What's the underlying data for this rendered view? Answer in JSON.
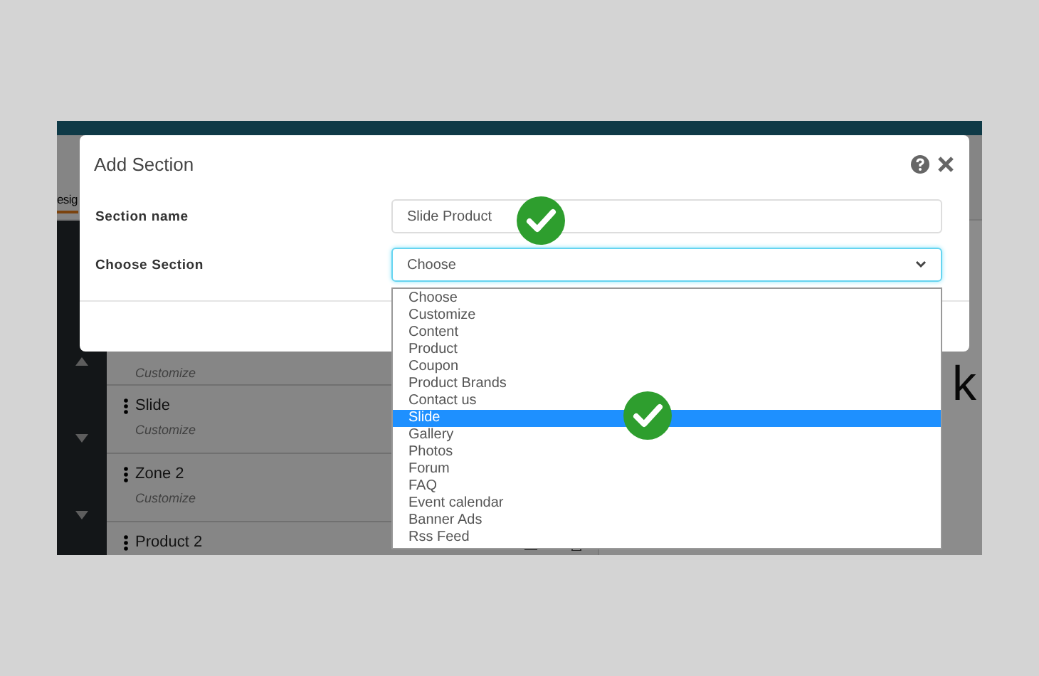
{
  "background": {
    "tab_partial": "esig",
    "heading_partial": "k",
    "rows": [
      {
        "subtitle": "Customize"
      },
      {
        "title": "Slide",
        "subtitle": "Customize"
      },
      {
        "title": "Zone 2",
        "subtitle": "Customize"
      },
      {
        "title": "Product 2"
      }
    ]
  },
  "dialog": {
    "title": "Add Section",
    "fields": [
      {
        "kind": "text",
        "label": "Section name",
        "value": "Slide Product"
      },
      {
        "kind": "select",
        "label": "Choose Section",
        "value": "Choose"
      }
    ],
    "options": [
      {
        "label": "Choose",
        "selected": false
      },
      {
        "label": "Customize",
        "selected": false
      },
      {
        "label": "Content",
        "selected": false
      },
      {
        "label": "Product",
        "selected": false
      },
      {
        "label": "Coupon",
        "selected": false
      },
      {
        "label": "Product Brands",
        "selected": false
      },
      {
        "label": "Contact us",
        "selected": false
      },
      {
        "label": "Slide",
        "selected": true
      },
      {
        "label": "Gallery",
        "selected": false
      },
      {
        "label": "Photos",
        "selected": false
      },
      {
        "label": "Forum",
        "selected": false
      },
      {
        "label": "FAQ",
        "selected": false
      },
      {
        "label": "Event calendar",
        "selected": false
      },
      {
        "label": "Banner Ads",
        "selected": false
      },
      {
        "label": "Rss Feed",
        "selected": false
      }
    ]
  }
}
